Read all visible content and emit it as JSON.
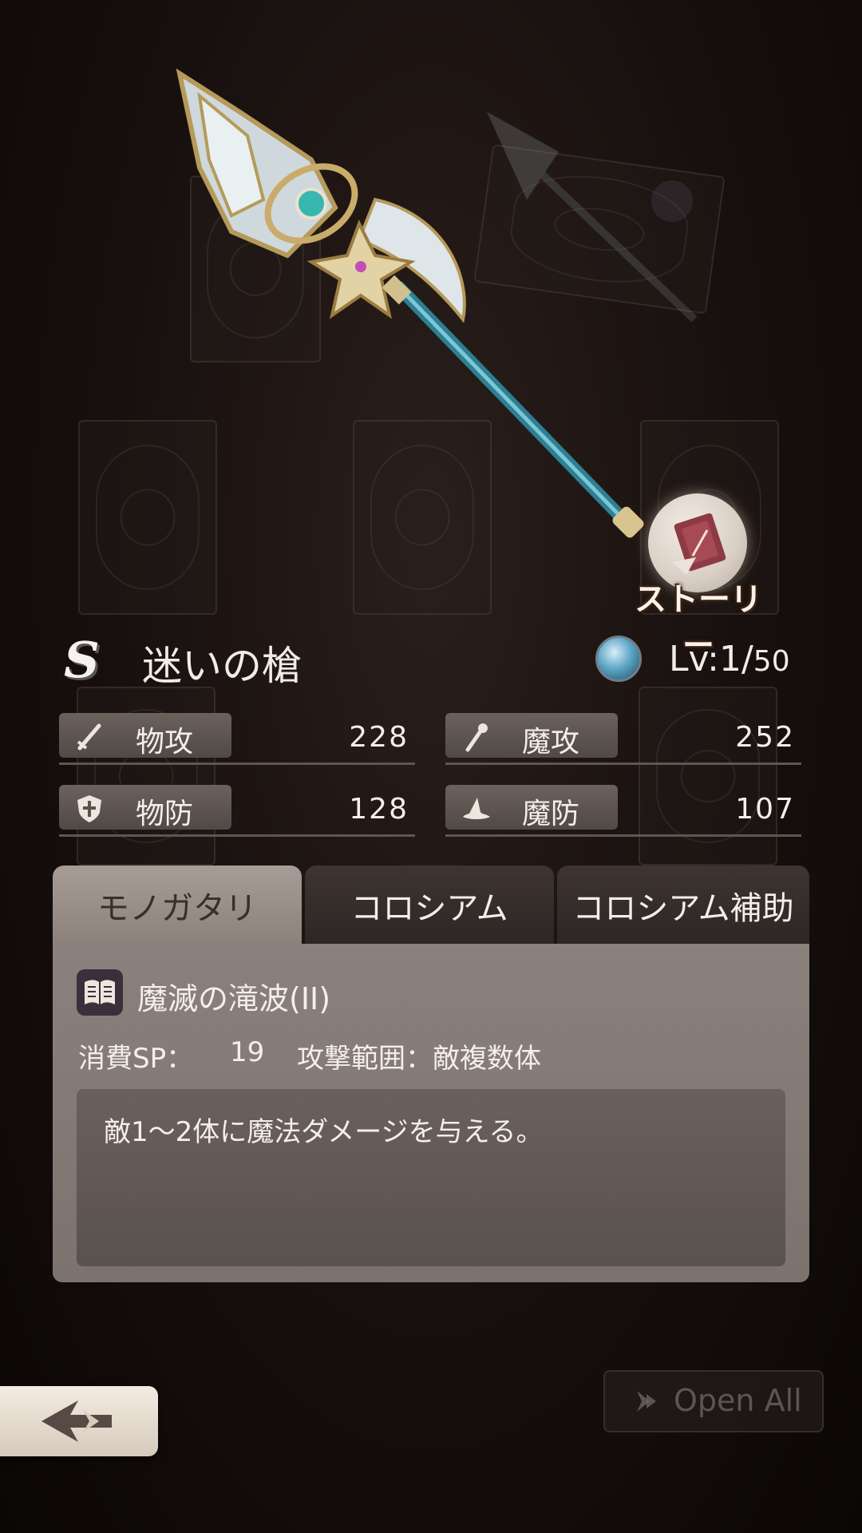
{
  "weapon": {
    "rank": "S",
    "name": "迷いの槍",
    "level_prefix": "Lv:1/",
    "level_max": "50",
    "element_icon": "water-element-icon"
  },
  "story_button": {
    "label": "ストーリー",
    "icon": "story-book-icon"
  },
  "stats": {
    "phys_atk": {
      "label": "物攻",
      "value": "228",
      "icon": "sword-icon"
    },
    "mag_atk": {
      "label": "魔攻",
      "value": "252",
      "icon": "wand-icon"
    },
    "phys_def": {
      "label": "物防",
      "value": "128",
      "icon": "shield-icon"
    },
    "mag_def": {
      "label": "魔防",
      "value": "107",
      "icon": "witch-hat-icon"
    }
  },
  "tabs": [
    {
      "label": "モノガタリ",
      "active": true
    },
    {
      "label": "コロシアム",
      "active": false
    },
    {
      "label": "コロシアム補助",
      "active": false
    }
  ],
  "skill": {
    "icon": "book-icon",
    "name": "魔滅の滝波(II)",
    "sp_label": "消費SP：",
    "sp_value": "19",
    "range": "攻撃範囲：敵複数体",
    "description": "敵1〜2体に魔法ダメージを与える。"
  },
  "footer": {
    "back_icon": "back-arrow-icon",
    "open_all_label": "Open All",
    "open_all_icon": "chevron-right-icon"
  }
}
